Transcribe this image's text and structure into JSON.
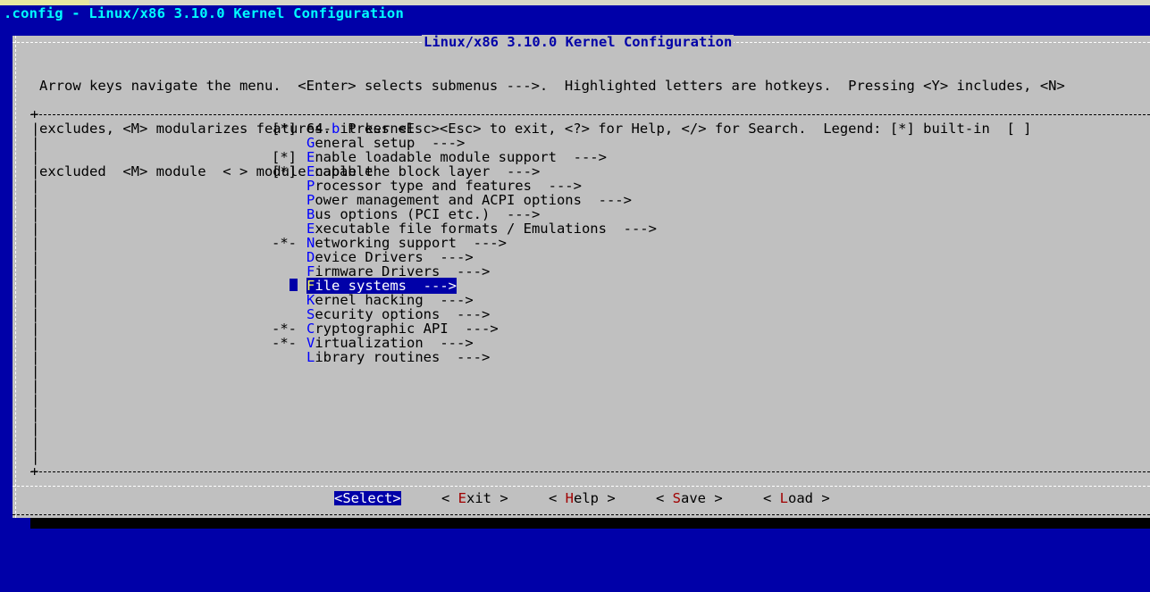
{
  "window": {
    "title": ".config - Linux/x86 3.10.0 Kernel Configuration"
  },
  "dialog": {
    "title": "Linux/x86 3.10.0 Kernel Configuration",
    "help_lines": [
      "Arrow keys navigate the menu.  <Enter> selects submenus --->.  Highlighted letters are hotkeys.  Pressing <Y> includes, <N>",
      "excludes, <M> modularizes features.  Press <Esc><Esc> to exit, <?> for Help, </> for Search.  Legend: [*] built-in  [ ]",
      "excluded  <M> module  < > module capable"
    ]
  },
  "menu": {
    "items": [
      {
        "prefix": "[*]",
        "hotkey": "",
        "pre_text": "64-",
        "hot_char": "b",
        "rest": "it kernel",
        "suffix": ""
      },
      {
        "prefix": "",
        "hotkey": "G",
        "pre_text": "",
        "hot_char": "G",
        "rest": "eneral setup",
        "suffix": "  --->"
      },
      {
        "prefix": "[*]",
        "hotkey": "E",
        "pre_text": "",
        "hot_char": "E",
        "rest": "nable loadable module support",
        "suffix": "  --->"
      },
      {
        "prefix": "[*]",
        "hotkey": "E",
        "pre_text": "",
        "hot_char": "E",
        "rest": "nable the block layer",
        "suffix": "  --->"
      },
      {
        "prefix": "",
        "hotkey": "P",
        "pre_text": "",
        "hot_char": "P",
        "rest": "rocessor type and features",
        "suffix": "  --->"
      },
      {
        "prefix": "",
        "hotkey": "P",
        "pre_text": "",
        "hot_char": "P",
        "rest": "ower management and ACPI options",
        "suffix": "  --->"
      },
      {
        "prefix": "",
        "hotkey": "B",
        "pre_text": "",
        "hot_char": "B",
        "rest": "us options (PCI etc.)",
        "suffix": "  --->"
      },
      {
        "prefix": "",
        "hotkey": "E",
        "pre_text": "",
        "hot_char": "E",
        "rest": "xecutable file formats / Emulations",
        "suffix": "  --->"
      },
      {
        "prefix": "-*-",
        "hotkey": "N",
        "pre_text": "",
        "hot_char": "N",
        "rest": "etworking support",
        "suffix": "  --->"
      },
      {
        "prefix": "",
        "hotkey": "D",
        "pre_text": "",
        "hot_char": "D",
        "rest": "evice Drivers",
        "suffix": "  --->"
      },
      {
        "prefix": "",
        "hotkey": "F",
        "pre_text": "",
        "hot_char": "F",
        "rest": "irmware Drivers",
        "suffix": "  --->"
      },
      {
        "prefix": "",
        "hotkey": "F",
        "pre_text": "",
        "hot_char": "F",
        "rest": "ile systems",
        "suffix": "  --->",
        "selected": true
      },
      {
        "prefix": "",
        "hotkey": "K",
        "pre_text": "",
        "hot_char": "K",
        "rest": "ernel hacking",
        "suffix": "  --->"
      },
      {
        "prefix": "",
        "hotkey": "S",
        "pre_text": "",
        "hot_char": "S",
        "rest": "ecurity options",
        "suffix": "  --->"
      },
      {
        "prefix": "-*-",
        "hotkey": "C",
        "pre_text": "",
        "hot_char": "C",
        "rest": "ryptographic API",
        "suffix": "  --->"
      },
      {
        "prefix": "-*-",
        "hotkey": "V",
        "pre_text": "",
        "hot_char": "V",
        "rest": "irtualization",
        "suffix": "  --->"
      },
      {
        "prefix": "",
        "hotkey": "L",
        "pre_text": "",
        "hot_char": "L",
        "rest": "ibrary routines",
        "suffix": "  --->"
      }
    ]
  },
  "buttons": {
    "select": "<Select>",
    "exit": {
      "open": "< ",
      "hot": "E",
      "rest": "xit",
      "close": " >"
    },
    "help": {
      "open": "< ",
      "hot": "H",
      "rest": "elp",
      "close": " >"
    },
    "save": {
      "open": "< ",
      "hot": "S",
      "rest": "ave",
      "close": " >"
    },
    "load": {
      "open": "< ",
      "hot": "L",
      "rest": "oad",
      "close": " >"
    }
  },
  "colors": {
    "background": "#0000a8",
    "dialog": "#c0c0c0",
    "title": "#00ffff",
    "hotkey": "#0000ff",
    "selection": "#0000a8"
  }
}
